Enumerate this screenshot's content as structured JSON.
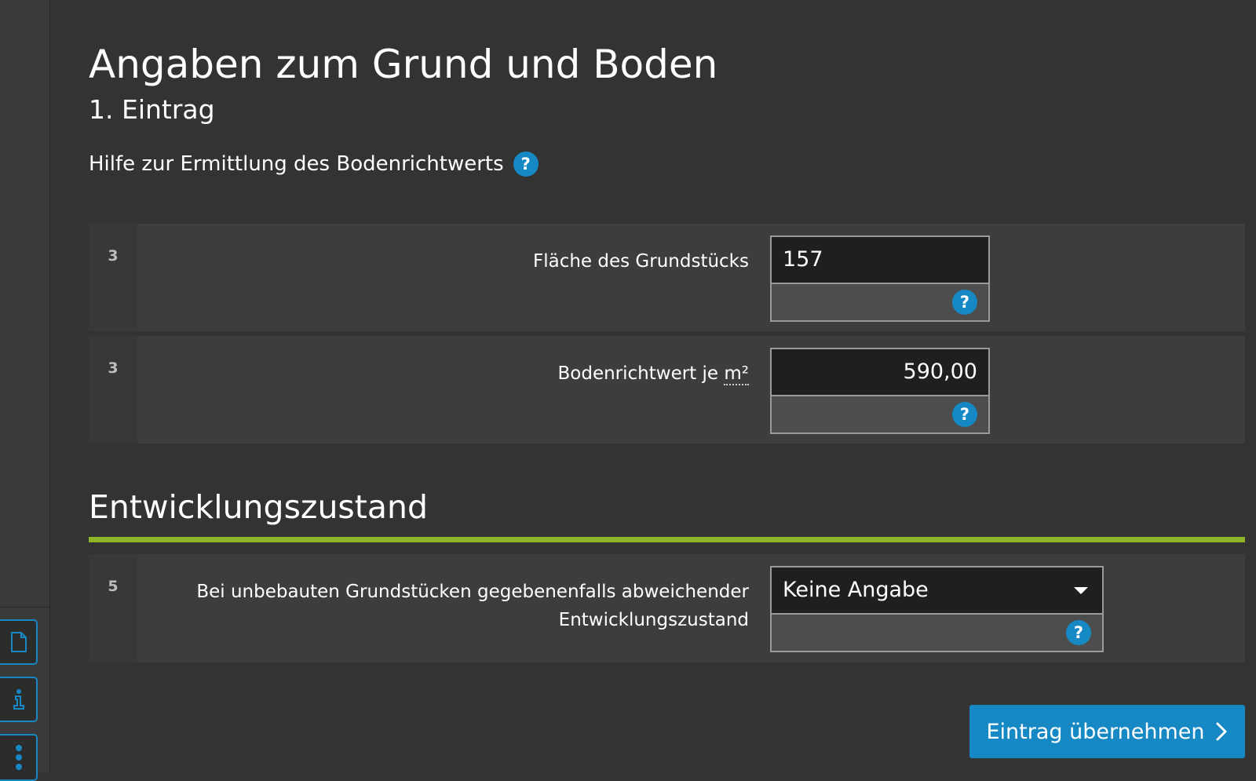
{
  "page": {
    "title": "Angaben zum Grund und Boden",
    "subtitle": "1. Eintrag",
    "help_text": "Hilfe zur Ermittlung des Bodenrichtwerts",
    "help_icon": "?"
  },
  "rows": [
    {
      "number": "3",
      "label": "Fläche des Grundstücks",
      "value": "157",
      "help_icon": "?"
    },
    {
      "number": "3",
      "label_prefix": "Bodenrichtwert je ",
      "label_unit": "m²",
      "value": "590,00",
      "help_icon": "?"
    }
  ],
  "section": {
    "title": "Entwicklungszustand",
    "accent_color": "#8db424"
  },
  "development_row": {
    "number": "5",
    "label_line1": "Bei unbebauten Grundstücken gegebenenfalls abweichender",
    "label_line2": "Entwicklungszustand",
    "selected": "Keine Angabe",
    "help_icon": "?"
  },
  "submit": {
    "label": "Eintrag übernehmen"
  },
  "sidebar": {
    "buttons": [
      {
        "icon": "document-icon"
      },
      {
        "icon": "info-icon"
      },
      {
        "icon": "more-icon"
      }
    ]
  },
  "colors": {
    "background": "#333333",
    "primary": "#1688c4",
    "accent": "#8db424"
  }
}
